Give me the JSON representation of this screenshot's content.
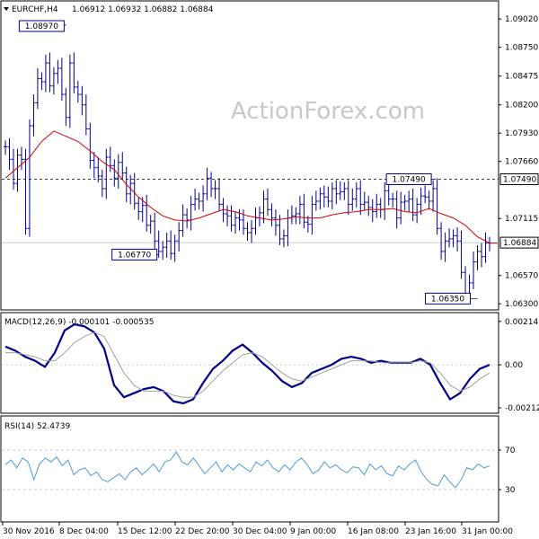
{
  "header": {
    "symbol": "EURCHF,H4",
    "ohlc": "1.06912 1.06932 1.06882 1.06884"
  },
  "watermark": "ActionForex.com",
  "colors": {
    "candle": "#00008b",
    "ma": "#d40000",
    "macd_main": "#00008b",
    "macd_signal": "#a0a0a0",
    "rsi": "#4d9bd8",
    "grid": "#bbbbbb",
    "label_bg": "#ffffff"
  },
  "chart_data": [
    {
      "type": "line",
      "name_label": "EURCHF,H4",
      "ylim": [
        1.0625,
        1.0915
      ],
      "y_ticks": [
        "1.09020",
        "1.08750",
        "1.08475",
        "1.08200",
        "1.07930",
        "1.07660",
        "1.07490",
        "1.07115",
        "1.06884",
        "1.06570",
        "1.06300"
      ],
      "close_series": [
        1.078,
        1.0768,
        1.0745,
        1.0772,
        1.0768,
        1.0702,
        1.08,
        1.0822,
        1.0845,
        1.0842,
        1.086,
        1.0838,
        1.085,
        1.0855,
        1.083,
        1.0808,
        1.086,
        1.0837,
        1.083,
        1.082,
        1.0797,
        1.0767,
        1.076,
        1.0752,
        1.074,
        1.077,
        1.0762,
        1.075,
        1.0765,
        1.0755,
        1.0735,
        1.0745,
        1.0726,
        1.0718,
        1.0724,
        1.0705,
        1.0709,
        1.069,
        1.068,
        1.0684,
        1.069,
        1.0678,
        1.069,
        1.07,
        1.0715,
        1.071,
        1.0725,
        1.073,
        1.0728,
        1.0735,
        1.075,
        1.074,
        1.074,
        1.0725,
        1.0716,
        1.0714,
        1.0705,
        1.0712,
        1.071,
        1.0702,
        1.0698,
        1.0702,
        1.0712,
        1.0717,
        1.073,
        1.072,
        1.0712,
        1.0705,
        1.0692,
        1.0695,
        1.0712,
        1.0714,
        1.0716,
        1.0725,
        1.0708,
        1.0706,
        1.0725,
        1.0728,
        1.0735,
        1.0732,
        1.0728,
        1.074,
        1.0735,
        1.0737,
        1.074,
        1.0725,
        1.073,
        1.074,
        1.0725,
        1.0727,
        1.0722,
        1.0718,
        1.0725,
        1.072,
        1.0738,
        1.073,
        1.073,
        1.0712,
        1.0727,
        1.0728,
        1.073,
        1.0715,
        1.0725,
        1.0733,
        1.0732,
        1.0728,
        1.074,
        1.0702,
        1.068,
        1.069,
        1.0692,
        1.0695,
        1.069,
        1.066,
        1.064,
        1.065,
        1.067,
        1.068,
        1.0675,
        1.0688,
        1.0688
      ],
      "ma_series": [
        1.075,
        1.076,
        1.077,
        1.0785,
        1.0795,
        1.079,
        1.0785,
        1.0776,
        1.0766,
        1.0758,
        1.0744,
        1.0732,
        1.0722,
        1.0714,
        1.071,
        1.0709,
        1.0712,
        1.0716,
        1.072,
        1.0718,
        1.0714,
        1.0712,
        1.071,
        1.0711,
        1.0713,
        1.0712,
        1.0712,
        1.0715,
        1.0717,
        1.0718,
        1.072,
        1.072,
        1.0721,
        1.0718,
        1.0717,
        1.0721,
        1.0716,
        1.0712,
        1.0705,
        1.0694,
        1.0688,
        1.0688
      ],
      "ma_x": [
        0,
        3,
        6,
        9,
        12,
        15,
        18,
        21,
        24,
        27,
        30,
        33,
        36,
        39,
        42,
        45,
        48,
        51,
        54,
        57,
        60,
        63,
        66,
        69,
        72,
        75,
        78,
        81,
        84,
        87,
        90,
        93,
        96,
        99,
        102,
        105,
        108,
        111,
        114,
        117,
        120,
        122
      ],
      "hline_value": 1.0749,
      "current_price": 1.06884,
      "annotations": [
        {
          "label": "1.08970",
          "value": 1.0897,
          "index": 15
        },
        {
          "label": "1.07490",
          "value": 1.0749,
          "index": 106
        },
        {
          "label": "1.06770",
          "value": 1.0677,
          "index": 38
        },
        {
          "label": "1.06350",
          "value": 1.0635,
          "index": 117
        }
      ],
      "price_labels": {
        "hline": "1.07490",
        "current": "1.06884"
      }
    },
    {
      "type": "line",
      "header": "MACD(12,26,9) -0.000101 -0.000535",
      "ylim": [
        -0.0023,
        0.0024
      ],
      "y_ticks": [
        {
          "label": "0.002145",
          "value": 0.002145
        },
        {
          "label": "0.00",
          "value": 0
        },
        {
          "label": "-0.002122",
          "value": -0.002122
        }
      ],
      "zero_line": 0,
      "series": [
        {
          "key": "main",
          "values": [
            0.0009,
            0.0007,
            0.0004,
            0.0002,
            -0.0001,
            0.0006,
            0.0017,
            0.002,
            0.0019,
            0.0016,
            0.0008,
            -0.001,
            -0.0016,
            -0.0014,
            -0.0012,
            -0.0011,
            -0.0013,
            -0.0018,
            -0.0019,
            -0.0017,
            -0.0009,
            -0.0002,
            0.0002,
            0.0007,
            0.001,
            0.0006,
            0.0001,
            -0.0003,
            -0.0008,
            -0.0011,
            -0.0009,
            -0.0004,
            -0.0002,
            0.0,
            0.0003,
            0.0004,
            0.0003,
            0.0001,
            0.0002,
            0.0001,
            0.0001,
            0.0001,
            0.0003,
            0.0,
            -0.0009,
            -0.0017,
            -0.0014,
            -0.0007,
            -0.0002,
            0.0
          ]
        },
        {
          "key": "signal",
          "values": [
            0.0006,
            0.0006,
            0.0005,
            0.0004,
            0.0002,
            0.0002,
            0.0006,
            0.0011,
            0.0014,
            0.0016,
            0.0014,
            0.0005,
            -0.0004,
            -0.001,
            -0.0013,
            -0.0013,
            -0.0013,
            -0.0015,
            -0.0016,
            -0.0016,
            -0.0013,
            -0.0008,
            -0.0003,
            0.0001,
            0.0005,
            0.0006,
            0.0004,
            0.0,
            -0.0004,
            -0.0007,
            -0.0008,
            -0.0006,
            -0.0004,
            -0.0002,
            0.0,
            0.0002,
            0.0002,
            0.0002,
            0.0001,
            0.0001,
            0.0001,
            0.0001,
            0.0002,
            0.0001,
            -0.0004,
            -0.001,
            -0.0013,
            -0.0011,
            -0.0007,
            -0.0004
          ]
        }
      ]
    },
    {
      "type": "line",
      "header": "RSI(14) 52.4739",
      "ylim": [
        0,
        100
      ],
      "y_ticks": [
        {
          "label": "70",
          "value": 70
        },
        {
          "label": "30",
          "value": 30
        }
      ],
      "levels": [
        70,
        30
      ],
      "values": [
        55,
        60,
        52,
        62,
        58,
        40,
        56,
        62,
        58,
        63,
        54,
        60,
        45,
        50,
        52,
        44,
        48,
        40,
        38,
        42,
        46,
        40,
        48,
        52,
        45,
        50,
        56,
        48,
        58,
        60,
        68,
        58,
        55,
        62,
        54,
        46,
        52,
        58,
        48,
        55,
        50,
        56,
        52,
        48,
        58,
        54,
        60,
        52,
        48,
        55,
        50,
        58,
        62,
        55,
        46,
        50,
        58,
        52,
        55,
        50,
        47,
        53,
        52,
        45,
        56,
        50,
        54,
        46,
        44,
        54,
        50,
        56,
        60,
        48,
        40,
        35,
        34,
        45,
        38,
        32,
        40,
        52,
        50,
        56,
        52,
        54
      ],
      "x_ticks": [
        "30 Nov 2016",
        "8 Dec 04:00",
        "15 Dec 12:00",
        "22 Dec 20:00",
        "30 Dec 04:00",
        "9 Jan 00:00",
        "16 Jan 08:00",
        "23 Jan 16:00",
        "31 Jan 00:00"
      ]
    }
  ]
}
